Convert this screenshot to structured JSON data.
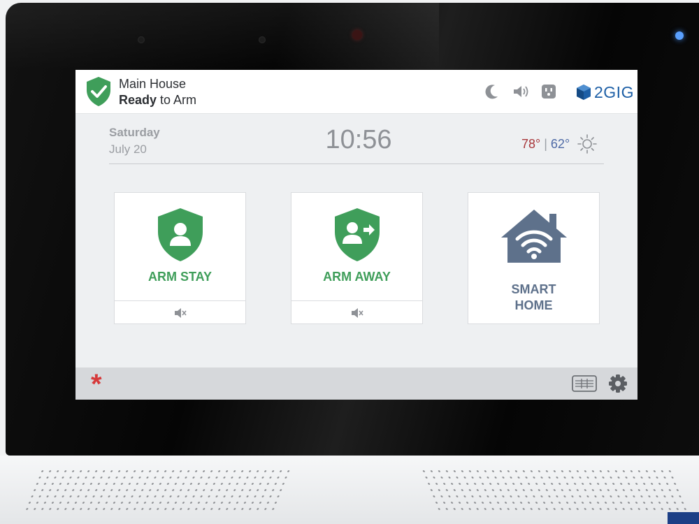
{
  "header": {
    "location": "Main House",
    "status_bold": "Ready",
    "status_rest": " to Arm",
    "icons": [
      "moon-icon",
      "speaker-icon",
      "outlet-icon"
    ],
    "brand": "2GIG"
  },
  "info": {
    "day": "Saturday",
    "date": "July 20",
    "time": "10:56",
    "temp_high": "78°",
    "separator": "|",
    "temp_low": "62°",
    "weather_icon": "sun-icon"
  },
  "tiles": [
    {
      "label": "ARM STAY",
      "icon": "shield-person-icon",
      "footer_icon": "mute-icon"
    },
    {
      "label": "ARM AWAY",
      "icon": "shield-person-arrow-icon",
      "footer_icon": "mute-icon"
    },
    {
      "label_line1": "SMART",
      "label_line2": "HOME",
      "icon": "wifi-house-icon"
    }
  ],
  "footer": {
    "left_icon": "emergency-asterisk-icon",
    "left_symbol": "*",
    "right_icons": [
      "keypad-icon",
      "gear-icon"
    ]
  },
  "colors": {
    "accent_green": "#3f9e5a",
    "alert_red": "#d6393a",
    "temp_high": "#a8363a",
    "temp_low": "#4e6aa6",
    "smart_home": "#5e718b",
    "brand_blue": "#1d5fa6"
  }
}
